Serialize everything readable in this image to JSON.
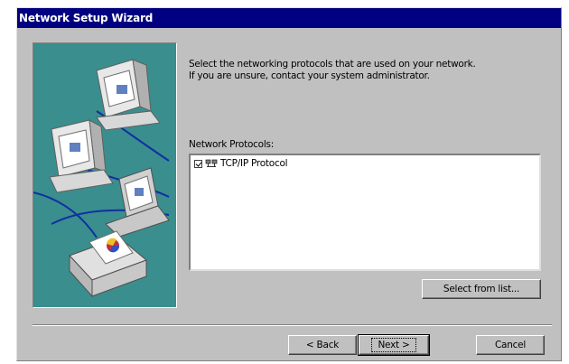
{
  "window": {
    "title": "Network Setup Wizard"
  },
  "intro": {
    "line1": "Select the networking protocols that are used on your network.",
    "line2": "If you are unsure, contact your system administrator."
  },
  "protocols": {
    "label": "Network Protocols:",
    "items": [
      {
        "label": "TCP/IP Protocol",
        "checked": true,
        "icon": "network-protocol-icon"
      }
    ]
  },
  "buttons": {
    "select_from_list": "Select from list...",
    "back": "< Back",
    "next": "Next >",
    "cancel": "Cancel"
  },
  "colors": {
    "titlebar": "#000080",
    "dialog_face": "#c0c0c0",
    "art_background": "#3a8e8e"
  },
  "illustration": "computers-connected-to-printer-illustration"
}
